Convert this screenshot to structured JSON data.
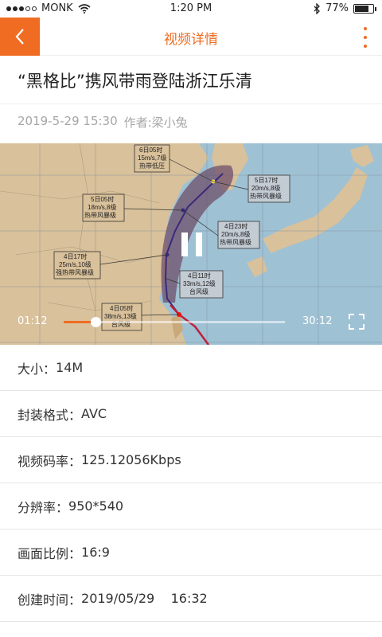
{
  "status_bar": {
    "carrier": "MONK",
    "time": "1:20 PM",
    "battery": "77%",
    "battery_level": 0.77,
    "icons": [
      "signal-icon",
      "wifi-icon",
      "bluetooth-icon",
      "battery-icon"
    ]
  },
  "nav": {
    "title": "视频详情",
    "accent_color": "#ef6c22",
    "back_icon": "chevron-left-icon",
    "more_icon": "more-vertical-icon"
  },
  "article": {
    "title": "“黑格比”携风带雨登陆浙江乐清",
    "date": "2019-5-29 15:30",
    "author": "作者:梁小兔"
  },
  "video": {
    "current_time": "01:12",
    "total_time": "30:12",
    "progress": 0.04,
    "state": "playing",
    "pause_icon": "pause-icon",
    "fullscreen_icon": "fullscreen-icon",
    "map_labels": [
      [
        "6日05时",
        "15m/s,7级",
        "热带低压"
      ],
      [
        "5日17时",
        "20m/s,8级",
        "热带风暴级"
      ],
      [
        "5日05时",
        "18m/s,8级",
        "热带风暴级"
      ],
      [
        "4日23时",
        "20m/s,8级",
        "热带风暴级"
      ],
      [
        "4日17时",
        "25m/s,10级",
        "强热带风暴级"
      ],
      [
        "4日11时",
        "33m/s,12级",
        "台风级"
      ],
      [
        "4日05时",
        "38m/s,13级",
        "台风级"
      ]
    ]
  },
  "info": [
    {
      "label": "大小：",
      "value": "14M"
    },
    {
      "label": "封装格式：",
      "value": "AVC"
    },
    {
      "label": "视频码率：",
      "value": "125.12056Kbps"
    },
    {
      "label": "分辨率：",
      "value": "950*540"
    },
    {
      "label": "画面比例：",
      "value": "16:9"
    },
    {
      "label": "创建时间：",
      "value": "2019/05/29    16:32"
    }
  ]
}
